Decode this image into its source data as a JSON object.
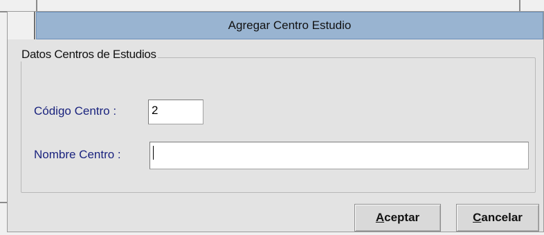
{
  "dialog": {
    "title": "Agregar Centro Estudio"
  },
  "group": {
    "legend": "Datos Centros de Estudios"
  },
  "fields": {
    "codigo_label": "Código Centro :",
    "codigo_value": "2",
    "nombre_label": "Nombre Centro :",
    "nombre_value": ""
  },
  "buttons": {
    "aceptar_mnemonic": "A",
    "aceptar_rest": "ceptar",
    "cancelar_mnemonic": "C",
    "cancelar_rest": "ancelar"
  },
  "colors": {
    "title_bar": "#99b4d1",
    "label_text": "#1a237e"
  }
}
